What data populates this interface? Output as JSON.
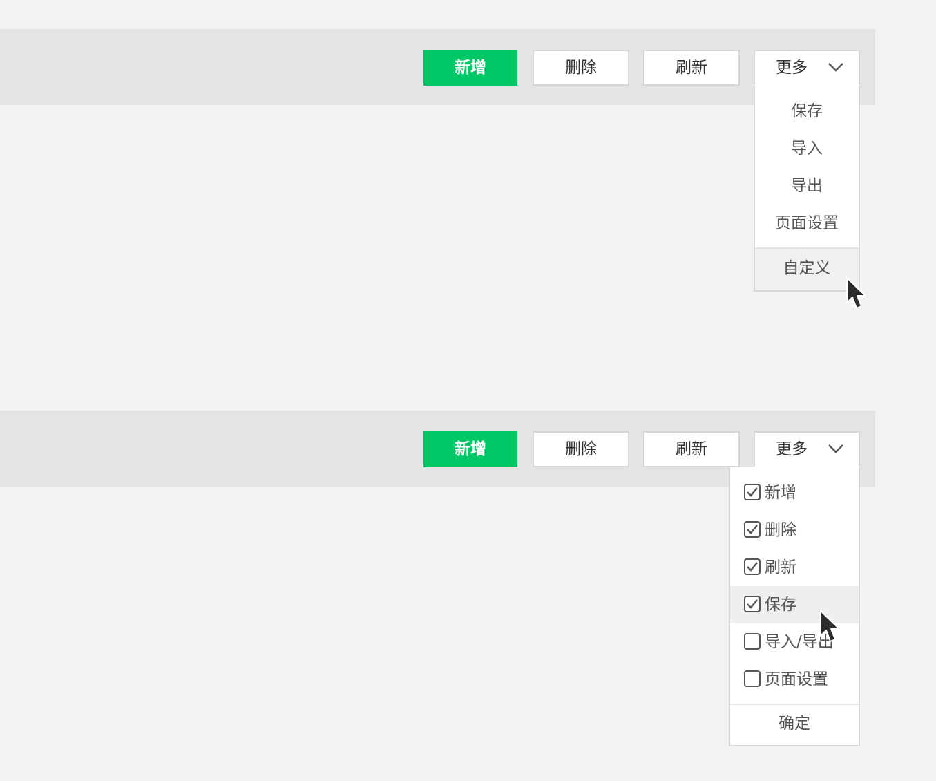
{
  "panel1": {
    "toolbar": {
      "add_label": "新增",
      "delete_label": "删除",
      "refresh_label": "刷新",
      "more_label": "更多"
    },
    "more_menu": {
      "items": [
        {
          "label": "保存"
        },
        {
          "label": "导入"
        },
        {
          "label": "导出"
        },
        {
          "label": "页面设置"
        }
      ],
      "custom_label": "自定义"
    }
  },
  "panel2": {
    "toolbar": {
      "add_label": "新增",
      "delete_label": "删除",
      "refresh_label": "刷新",
      "more_label": "更多"
    },
    "custom_menu": {
      "items": [
        {
          "label": "新增",
          "checked": true
        },
        {
          "label": "删除",
          "checked": true
        },
        {
          "label": "刷新",
          "checked": true
        },
        {
          "label": "保存",
          "checked": true,
          "hovered": true
        },
        {
          "label": "导入/导出",
          "checked": false
        },
        {
          "label": "页面设置",
          "checked": false
        }
      ],
      "confirm_label": "确定"
    }
  },
  "colors": {
    "primary": "#00c866",
    "toolbar_bg": "#e4e4e4",
    "page_bg": "#f2f2f2",
    "border": "#d6d6d6"
  },
  "icons": {
    "dropdown": "chevron-down-icon",
    "checkbox_checked": "checkbox-checked-icon",
    "checkbox_empty": "checkbox-empty-icon",
    "cursor": "mouse-pointer-icon"
  }
}
